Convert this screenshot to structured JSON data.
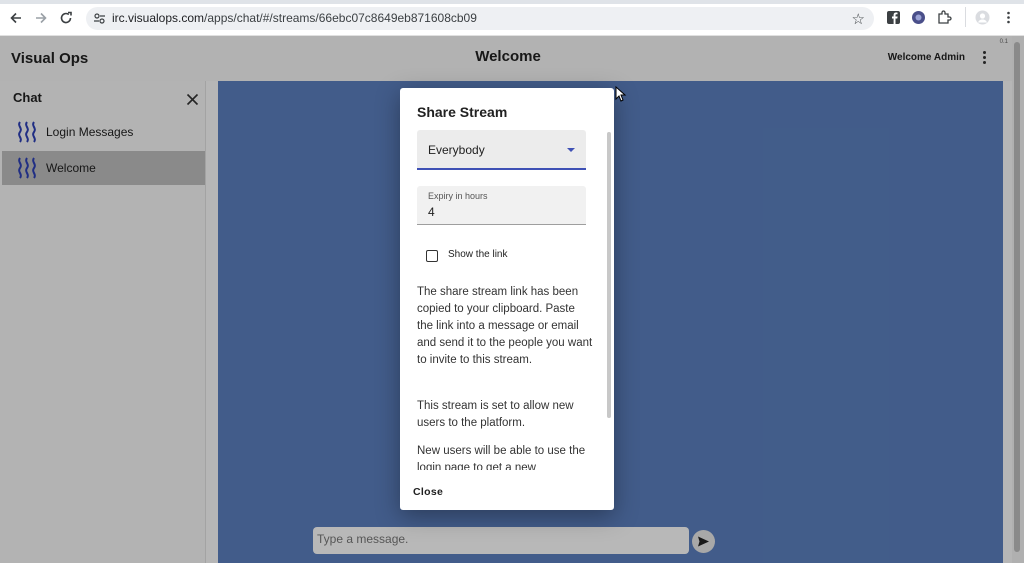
{
  "browser": {
    "url_domain": "irc.visualops.com",
    "url_path": "/apps/chat/#/streams/66ebc07c8649eb871608cb09"
  },
  "app": {
    "brand": "Visual Ops",
    "page_title": "Welcome",
    "user_greeting": "Welcome Admin",
    "version": "0.1"
  },
  "sidebar": {
    "title": "Chat",
    "channels": [
      {
        "label": "Login Messages",
        "icon": "stream-waves-icon",
        "active": false
      },
      {
        "label": "Welcome",
        "icon": "stream-waves-icon",
        "active": true
      }
    ]
  },
  "composer": {
    "placeholder": "Type a message."
  },
  "dialog": {
    "title": "Share Stream",
    "audience_select": "Everybody",
    "expiry_label": "Expiry in hours",
    "expiry_value": "4",
    "show_link_label": "Show the link",
    "show_link_checked": false,
    "paragraph_1": "The share stream link has been copied to your clipboard. Paste the link into a message or email and send it to the people you want to invite to this stream.",
    "paragraph_2": "This stream is set to allow new users to the platform.",
    "paragraph_3": "New users will be able to use the login page to get a new",
    "close_label": "Close"
  },
  "colors": {
    "accent": "#3f51b5",
    "main_bg": "#5b7fbd",
    "active_item": "#bdbdbd"
  }
}
